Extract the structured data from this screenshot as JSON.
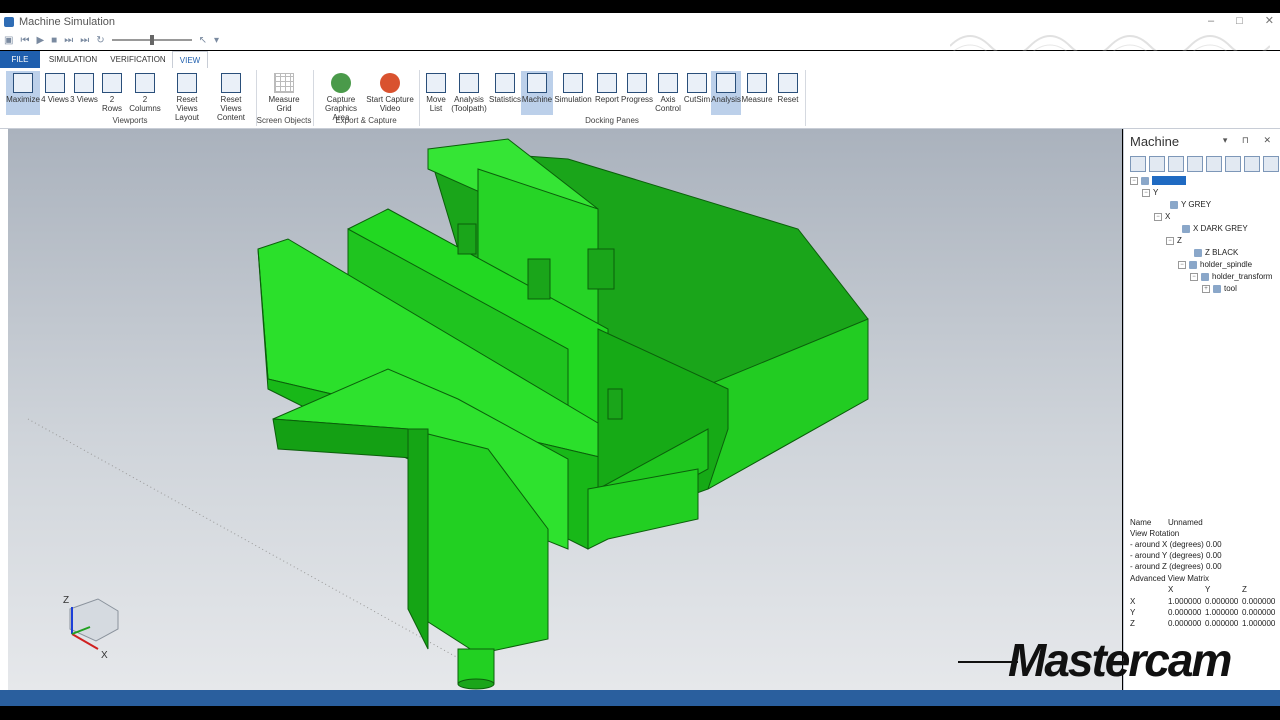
{
  "window": {
    "title": "Machine Simulation",
    "controls": [
      "–",
      "□",
      "✕"
    ]
  },
  "tabs": [
    {
      "label": "FILE"
    },
    {
      "label": "SIMULATION"
    },
    {
      "label": "VERIFICATION"
    },
    {
      "label": "VIEW"
    }
  ],
  "ribbon": {
    "viewports": [
      "Maximize",
      "4 Views",
      "3 Views",
      "2 Rows",
      "2 Columns",
      "Reset Views Layout",
      "Reset Views Content"
    ],
    "screen_objects": [
      "Measure Grid"
    ],
    "export_capture": [
      "Capture Graphics Area",
      "Start Capture Video"
    ],
    "docking": [
      "Move List",
      "Analysis (Toolpath)",
      "Statistics",
      "Machine",
      "Simulation",
      "Report",
      "Progress",
      "Axis Control",
      "CutSim",
      "Analysis",
      "Measure",
      "Reset"
    ],
    "groups": {
      "viewports": "Viewports",
      "screen_objects": "Screen Objects",
      "export_capture": "Export & Capture",
      "docking": "Docking Panes"
    }
  },
  "panel": {
    "title": "Machine",
    "tree": [
      "Y",
      "Y GREY",
      "X",
      "X DARK GREY",
      "Z",
      "Z BLACK",
      "holder_spindle",
      "holder_transform",
      "tool"
    ]
  },
  "props": {
    "name_label": "Name",
    "name_value": "Unnamed",
    "view_rotation": "View Rotation",
    "rot_x": "- around X (degrees)",
    "rot_y": "- around Y (degrees)",
    "rot_z": "- around Z (degrees)",
    "rot_val": "0.00",
    "advanced": "Advanced View Matrix",
    "col_x": "X",
    "col_y": "Y",
    "col_z": "Z",
    "rows": [
      {
        "label": "X",
        "v": [
          "1.000000",
          "0.000000",
          "0.000000"
        ]
      },
      {
        "label": "Y",
        "v": [
          "0.000000",
          "1.000000",
          "0.000000"
        ]
      },
      {
        "label": "Z",
        "v": [
          "0.000000",
          "0.000000",
          "1.000000"
        ]
      }
    ]
  },
  "triad": {
    "z": "Z",
    "x": "X"
  },
  "watermark": "Mastercam",
  "colors": {
    "accent": "#1f5fae",
    "model": "#22dd22",
    "model_dark": "#11a811",
    "status": "#2a5f9e"
  }
}
